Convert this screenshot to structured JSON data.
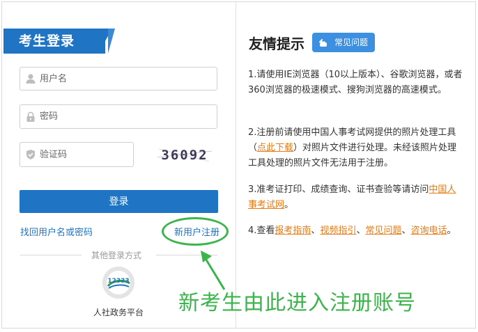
{
  "login": {
    "title": "考生登录",
    "username_placeholder": "用户名",
    "password_placeholder": "密码",
    "captcha_placeholder": "验证码",
    "captcha_text": "36092",
    "login_button": "登录",
    "forgot_link": "找回用户名或密码",
    "register_link": "新用户注册",
    "other_methods": "其他登录方式",
    "gov_platform_label": "人社政务平台",
    "gov_logo_text": "12333"
  },
  "annotation": {
    "note": "新考生由此进入注册账号",
    "color": "#3ab54a"
  },
  "tips": {
    "title": "友情提示",
    "faq_badge": "常见问题",
    "items": [
      {
        "text": "1.请使用IE浏览器（10以上版本）、谷歌浏览器，或者360浏览器的极速模式、搜狗浏览器的高速模式。"
      },
      {
        "prefix": "2.注册前请使用中国人事考试网提供的照片处理工具（",
        "link": "点此下载",
        "suffix": "）对照片文件进行处理。未经该照片处理工具处理的照片文件无法用于注册。"
      },
      {
        "prefix": "3.准考证打印、成绩查询、证书查验等请访问",
        "link": "中国人事考试网",
        "suffix": "。"
      },
      {
        "prefix": "4.查看",
        "links": [
          "报考指南",
          "视频指引",
          "常见问题",
          "咨询电话"
        ],
        "sep": "、",
        "suffix": "。"
      }
    ]
  },
  "colors": {
    "brand_blue": "#1f74c4",
    "link_orange": "#e67a12",
    "highlight_green": "#3ab54a"
  },
  "icons": [
    "user-icon",
    "lock-icon",
    "shield-icon",
    "hand-pointer-icon",
    "arrow-icon"
  ]
}
